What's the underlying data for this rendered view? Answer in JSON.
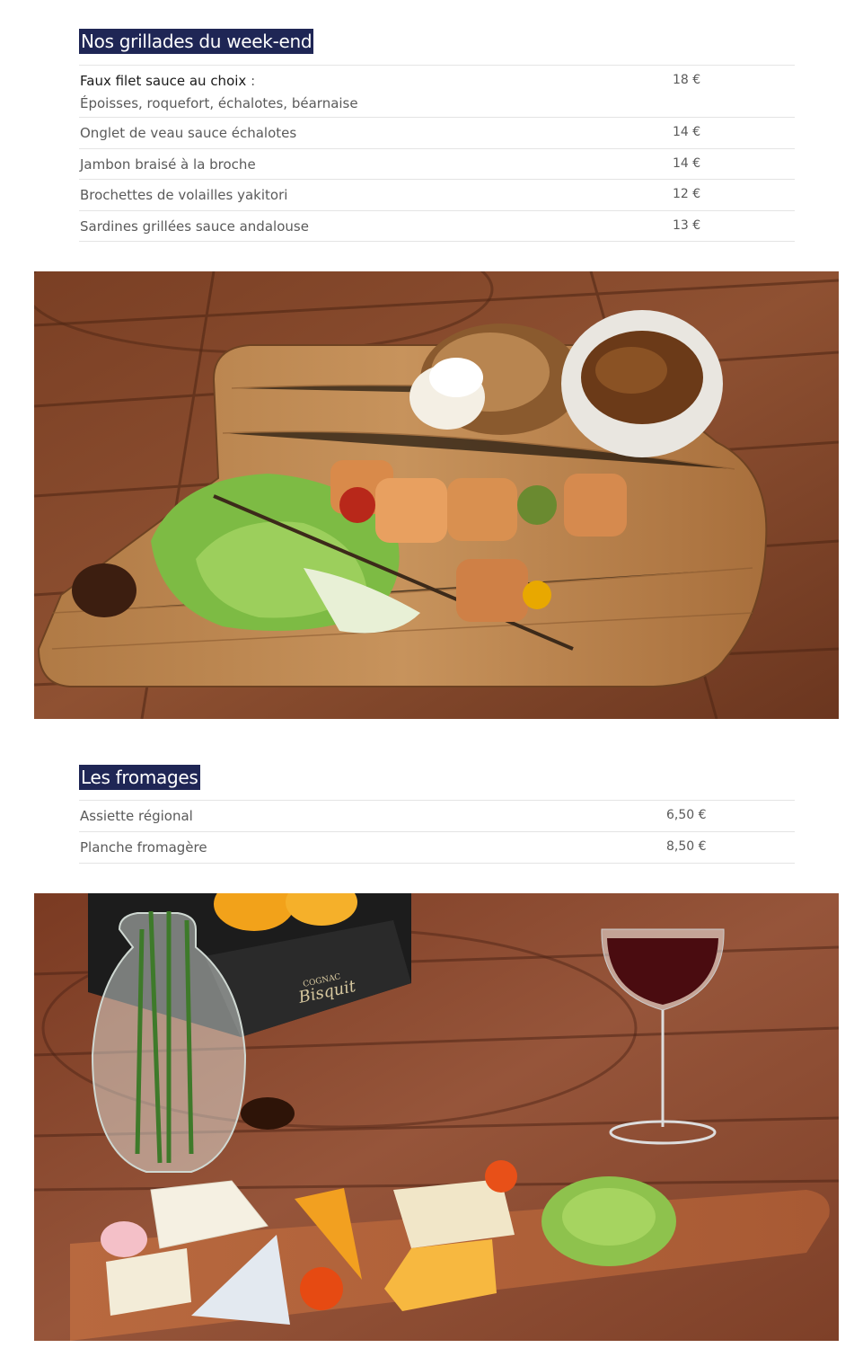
{
  "grillades": {
    "title": "Nos grillades du week-end",
    "items": [
      {
        "name": "Faux filet sauce au choix",
        "name_suffix": " :",
        "detail": "Époisses, roquefort, échalotes, béarnaise",
        "price": "18 €"
      },
      {
        "name": "Onglet de veau sauce échalotes",
        "price": "14 €"
      },
      {
        "name": "Jambon braisé à la broche",
        "price": "14 €"
      },
      {
        "name": "Brochettes de volailles yakitori",
        "price": "12 €"
      },
      {
        "name": "Sardines grillées sauce andalouse",
        "price": "13 €"
      }
    ]
  },
  "photo_skewer": {
    "description_hidden": ""
  },
  "fromages": {
    "title": "Les fromages",
    "items": [
      {
        "name": "Assiette régional",
        "price": "6,50 €"
      },
      {
        "name": "Planche fromagère",
        "price": "8,50 €"
      }
    ]
  },
  "photo_cheese": {
    "box_brand_small": "COGNAC",
    "box_brand": "Bisquit"
  },
  "colors": {
    "title_bg": "#1f2655",
    "divider": "#e4e4e4",
    "wood": "#8a4a2c"
  }
}
